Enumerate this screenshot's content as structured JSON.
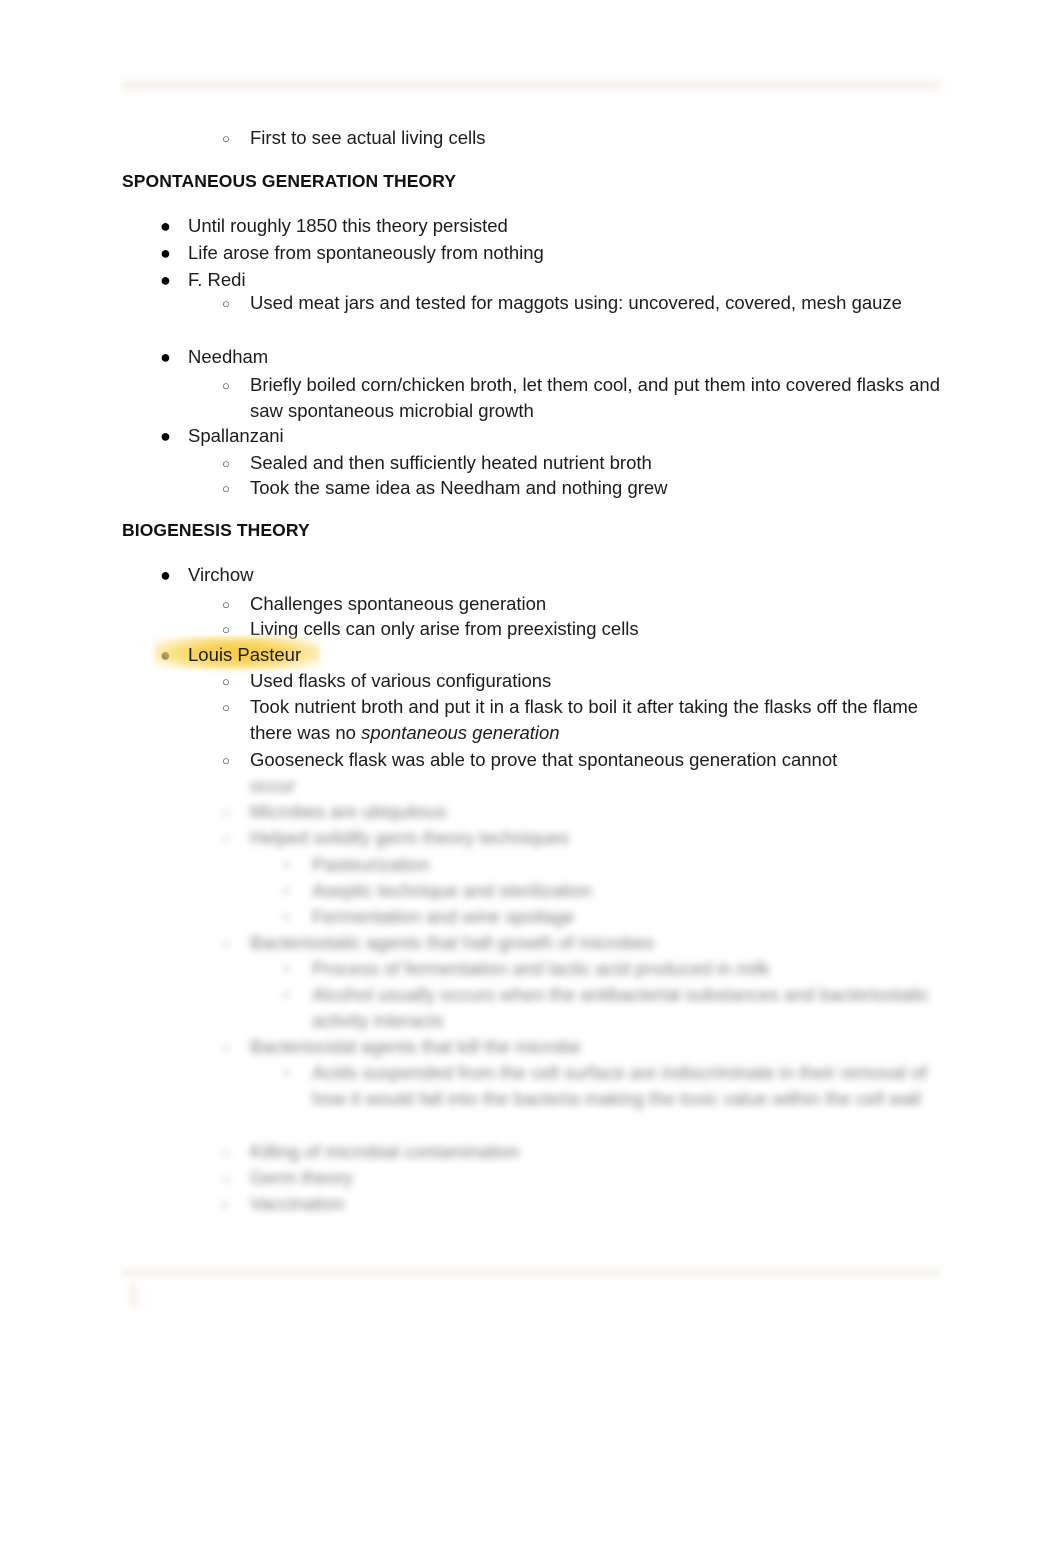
{
  "document": {
    "background_color": "#ffffff",
    "text_color": "#1c1c1c",
    "highlight_color": "#f7c93e",
    "band_color": "#f3efe4"
  },
  "bullets": {
    "level1": "●",
    "level2": "○",
    "level3": "▪"
  },
  "content": [
    {
      "type": "bullet",
      "level": 2,
      "text": "First to see actual living cells"
    },
    {
      "type": "heading",
      "text": "SPONTANEOUS GENERATION THEORY"
    },
    {
      "type": "bullet",
      "level": 1,
      "text": "Until roughly 1850 this theory persisted"
    },
    {
      "type": "bullet",
      "level": 1,
      "text": "Life arose from spontaneously from nothing"
    },
    {
      "type": "bullet",
      "level": 1,
      "text": "F. Redi"
    },
    {
      "type": "bullet",
      "level": 2,
      "text": "Used meat jars and tested for maggots using: uncovered, covered, mesh gauze"
    },
    {
      "type": "bullet",
      "level": 1,
      "text": "Needham"
    },
    {
      "type": "bullet",
      "level": 2,
      "text": "Briefly boiled corn/chicken broth, let them cool, and put them into covered flasks and saw spontaneous microbial growth"
    },
    {
      "type": "bullet",
      "level": 1,
      "text": "Spallanzani"
    },
    {
      "type": "bullet",
      "level": 2,
      "text": "Sealed and then sufficiently heated nutrient broth"
    },
    {
      "type": "bullet",
      "level": 2,
      "text": "Took the same idea as Needham and nothing grew"
    },
    {
      "type": "heading",
      "text": "BIOGENESIS THEORY"
    },
    {
      "type": "bullet",
      "level": 1,
      "text": "Virchow"
    },
    {
      "type": "bullet",
      "level": 2,
      "text": "Challenges spontaneous generation"
    },
    {
      "type": "bullet",
      "level": 2,
      "text": "Living cells can only arise from preexisting cells"
    },
    {
      "type": "bullet",
      "level": 1,
      "text": "Louis Pasteur",
      "highlighted": true
    },
    {
      "type": "bullet",
      "level": 2,
      "text": "Used flasks of various configurations"
    },
    {
      "type": "bullet",
      "level": 2,
      "text_before_italic": "Took nutrient broth and put it in a flask to boil it after taking the flasks off the flame there was no ",
      "italic_text": "spontaneous generation"
    },
    {
      "type": "bullet",
      "level": 2,
      "text": "Gooseneck flask was able to prove that spontaneous generation cannot"
    }
  ],
  "obscured_section": {
    "note": "lower portion of page is blurred and unreadable",
    "lines": [
      {
        "level": 2,
        "text": "occur"
      },
      {
        "level": 2,
        "text": "Microbes are ubiquitous"
      },
      {
        "level": 2,
        "text": "Helped solidify germ theory techniques"
      },
      {
        "level": 3,
        "text": "Pasteurization"
      },
      {
        "level": 3,
        "text": "Aseptic technique and sterilization"
      },
      {
        "level": 3,
        "text": "Fermentation and wine spoilage"
      },
      {
        "level": 2,
        "text": "Bacteriostatic agents that halt growth of microbes"
      },
      {
        "level": 3,
        "text": "Process of fermentation and lactic acid produced in milk"
      },
      {
        "level": 3,
        "text": "Alcohol usually occurs when the antibacterial substances and bacteriostatic activity interacts"
      },
      {
        "level": 2,
        "text": "Bacteriocidal agents that kill the microbe"
      },
      {
        "level": 3,
        "text": "Acids suspended from the cell surface are indiscriminate in their removal of how it would fall into the bacteria making the toxic value within the cell wall"
      },
      {
        "level": 2,
        "text": "Killing of microbial contamination"
      },
      {
        "level": 2,
        "text": "Germ theory"
      },
      {
        "level": 2,
        "text": "Vaccination"
      }
    ]
  }
}
